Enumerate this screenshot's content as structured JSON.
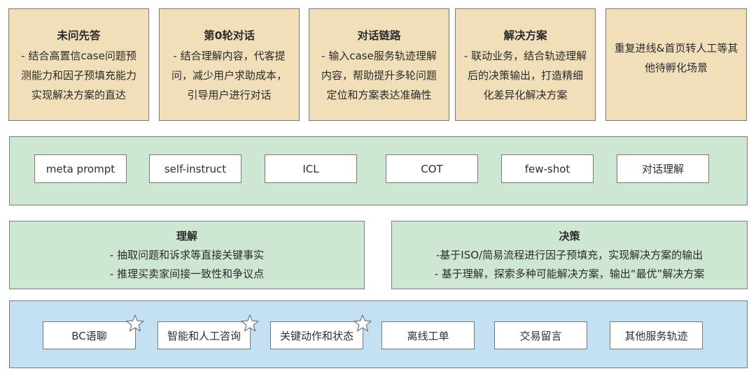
{
  "scenarios": [
    {
      "title": "未问先答",
      "desc": "- 结合高置信case问题预\n测能力和因子预填充能力\n实现解决方案的直达"
    },
    {
      "title": "第0轮对话",
      "desc": "- 结合理解内容，代客提\n问，减少用户求助成本，\n引导用户进行对话"
    },
    {
      "title": "对话链路",
      "desc": "- 输入case服务轨迹理解\n内容，帮助提升多轮问题\n定位和方案表达准确性"
    },
    {
      "title": "解决方案",
      "desc": "- 联动业务，结合轨迹理解\n后的决策输出，打造精细\n化差异化解决方案"
    },
    {
      "title": "",
      "desc": "重复进线&首页转人工等其\n他待孵化场景"
    }
  ],
  "techniques": [
    "meta prompt",
    "self-instruct",
    "ICL",
    "COT",
    "few-shot",
    "对话理解"
  ],
  "capabilities": {
    "understanding": {
      "title": "理解",
      "lines": [
        "- 抽取问题和诉求等直接关键事实",
        "- 推理买卖家间接一致性和争议点"
      ]
    },
    "decision": {
      "title": "决策",
      "lines": [
        "-基于ISO/简易流程进行因子预填充，实现解决方案的输出",
        "- 基于理解，探索多种可能解决方案，输出“最优”解决方案"
      ]
    }
  },
  "data_sources": [
    {
      "label": "BC语聊",
      "starred": true
    },
    {
      "label": "智能和人工咨询",
      "starred": true
    },
    {
      "label": "关键动作和状态",
      "starred": true
    },
    {
      "label": "离线工单",
      "starred": false
    },
    {
      "label": "交易留言",
      "starred": false
    },
    {
      "label": "其他服务轨迹",
      "starred": false
    }
  ],
  "colors": {
    "scenario_bg": "#f0dfb9",
    "technique_bg": "#cde7d2",
    "data_bg": "#c4e0f3",
    "chip_bg": "#ffffff"
  }
}
